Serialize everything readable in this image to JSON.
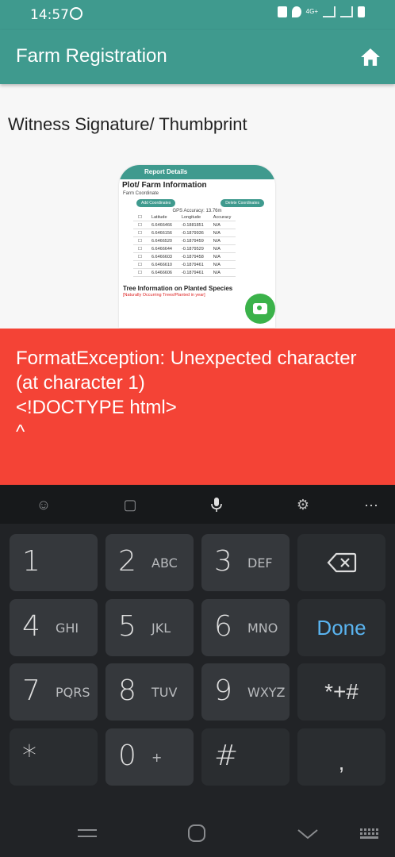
{
  "status_bar": {
    "time": "14:57",
    "network": "4G+"
  },
  "app_bar": {
    "title": "Farm Registration"
  },
  "section": {
    "witness_label": "Witness Signature/ Thumbprint"
  },
  "thumbnail": {
    "header": "Report Details",
    "heading": "Plot/ Farm Information",
    "subheading": "Farm Coordinate",
    "buttons": [
      "Add Coordinates",
      "Delete Coordinates"
    ],
    "accuracy": "GPS Accuracy: 13.76m",
    "columns": [
      "Latitude",
      "Longitude",
      "Accuracy"
    ],
    "rows": [
      [
        "6.6466466",
        "-0.1881851",
        "N/A"
      ],
      [
        "6.6466156",
        "-0.1879936",
        "N/A"
      ],
      [
        "6.6466520",
        "-0.1879459",
        "N/A"
      ],
      [
        "6.6466644",
        "-0.1879529",
        "N/A"
      ],
      [
        "6.6466603",
        "-0.1879458",
        "N/A"
      ],
      [
        "6.6466610",
        "-0.1879461",
        "N/A"
      ],
      [
        "6.6466606",
        "-0.1879461",
        "N/A"
      ]
    ],
    "tree_heading": "Tree Information on Planted Species",
    "tree_note": "[Naturally Occurring Trees/Planted in year]"
  },
  "error": {
    "message": "FormatException: Unexpected character (at character 1)\n<!DOCTYPE html>\n^"
  },
  "keyboard": {
    "keys": [
      {
        "num": "1",
        "sub": ""
      },
      {
        "num": "2",
        "sub": "ABC"
      },
      {
        "num": "3",
        "sub": "DEF"
      },
      {
        "num": "4",
        "sub": "GHI"
      },
      {
        "num": "5",
        "sub": "JKL"
      },
      {
        "num": "6",
        "sub": "MNO"
      },
      {
        "num": "7",
        "sub": "PQRS"
      },
      {
        "num": "8",
        "sub": "TUV"
      },
      {
        "num": "9",
        "sub": "WXYZ"
      },
      {
        "num": "*",
        "sub": ""
      },
      {
        "num": "0",
        "sub": "+"
      },
      {
        "num": "#",
        "sub": ""
      }
    ],
    "done_label": "Done",
    "symbols_label": "*+#",
    "comma_label": ",",
    "more_label": "···"
  },
  "colors": {
    "primary": "#3f9a8e",
    "error": "#f44336",
    "fab": "#3bb24a",
    "keyboard_bg": "#212326",
    "done_accent": "#5ab4f0"
  },
  "icons": {
    "appbar_action": "home-icon",
    "fab": "camera-icon",
    "keyboard_toolbar": [
      "emoji-icon",
      "sticker-icon",
      "microphone-icon",
      "settings-icon",
      "more-icon"
    ],
    "backspace": "backspace-icon",
    "navigation": [
      "recent-apps-icon",
      "home-nav-icon",
      "back-icon",
      "keyboard-icon"
    ]
  }
}
